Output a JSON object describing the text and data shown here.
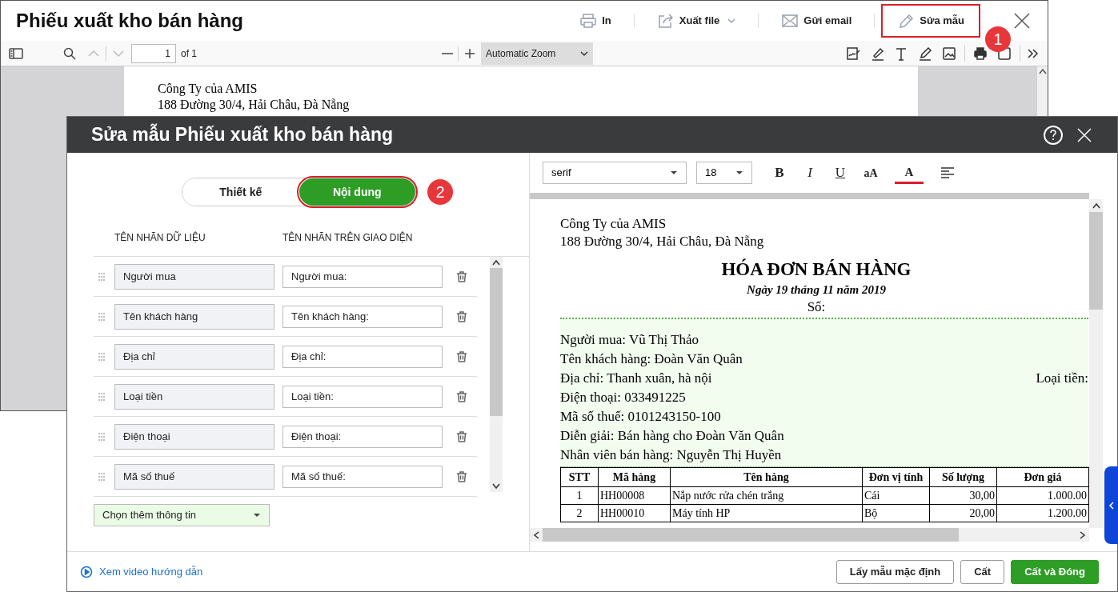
{
  "background_window": {
    "title": "Phiếu xuất kho bán hàng",
    "actions": [
      {
        "label": "In",
        "kind": "print",
        "highlighted": false
      },
      {
        "label": "Xuất file",
        "kind": "export",
        "highlighted": false
      },
      {
        "label": "Gửi email",
        "kind": "email",
        "highlighted": false
      },
      {
        "label": "Sửa mẫu",
        "kind": "edit",
        "highlighted": true
      }
    ],
    "callout": "1",
    "viewer_toolbar": {
      "page": "1",
      "page_count": "of 1",
      "zoom": "Automatic Zoom"
    },
    "page_lines": [
      "Công Ty của AMIS",
      "188 Đường 30/4, Hải Châu, Đà Nẵng"
    ]
  },
  "dialog": {
    "title": "Sửa mẫu Phiếu xuất kho bán hàng",
    "tabs": [
      {
        "label": "Thiết kế",
        "selected": false,
        "highlighted": false
      },
      {
        "label": "Nội dung",
        "selected": true,
        "highlighted": true
      }
    ],
    "tab_callout": "2",
    "columns": [
      "TÊN NHÃN DỮ LIỆU",
      "TÊN NHÃN TRÊN GIAO DIỆN"
    ],
    "fields": [
      {
        "data_label": "Người mua",
        "display_label": "Người mua:"
      },
      {
        "data_label": "Tên khách hàng",
        "display_label": "Tên khách hàng:"
      },
      {
        "data_label": "Địa chỉ",
        "display_label": "Địa chỉ:"
      },
      {
        "data_label": "Loại tiền",
        "display_label": "Loại tiền:"
      },
      {
        "data_label": "Điện thoại",
        "display_label": "Điện thoại:"
      },
      {
        "data_label": "Mã số thuế",
        "display_label": "Mã số thuế:"
      }
    ],
    "add_select": "Chọn thêm thông tin",
    "editor_toolbar": {
      "font": "serif",
      "size": "18",
      "buttons": [
        {
          "label": "B",
          "kind": "bold"
        },
        {
          "label": "I",
          "kind": "italic"
        },
        {
          "label": "U",
          "kind": "underline"
        },
        {
          "label": "aA",
          "kind": "case"
        },
        {
          "label": "A",
          "kind": "color"
        },
        {
          "kind": "align"
        }
      ]
    },
    "preview": {
      "company_lines": [
        "Công Ty của AMIS",
        "188 Đường 30/4, Hải Châu, Đà Nẵng"
      ],
      "title": "HÓA ĐƠN BÁN HÀNG",
      "date": "Ngày 19 tháng 11 năm 2019",
      "number_label": "Số:",
      "info_lines": [
        {
          "text": "Người mua: Vũ Thị Thảo"
        },
        {
          "text": "Tên khách hàng: Đoàn Văn Quân"
        },
        {
          "text": "Địa chỉ: Thanh xuân, hà nội",
          "right": "Loại tiền:"
        },
        {
          "text": "Điện thoại: 033491225"
        },
        {
          "text": "Mã số thuế: 0101243150-100"
        },
        {
          "text": "Diễn giải: Bán hàng cho Đoàn Văn Quân"
        },
        {
          "text": "Nhân viên bán hàng: Nguyễn Thị Huyền"
        }
      ],
      "table": {
        "columns": [
          "STT",
          "Mã hàng",
          "Tên hàng",
          "Đơn vị tính",
          "Số lượng",
          "Đơn giá"
        ],
        "rows": [
          [
            "1",
            "HH00008",
            "Nắp nước rửa chén trắng",
            "Cái",
            "30,00",
            "1.000.00"
          ],
          [
            "2",
            "HH00010",
            "Máy tính HP",
            "Bộ",
            "20,00",
            "1.200.00"
          ]
        ]
      }
    },
    "footer": {
      "link": "Xem video hướng dẫn",
      "buttons": [
        {
          "label": "Lấy mẫu mặc định",
          "kind": "secondary"
        },
        {
          "label": "Cất",
          "kind": "secondary"
        },
        {
          "label": "Cất và Đóng",
          "kind": "primary"
        }
      ]
    }
  }
}
